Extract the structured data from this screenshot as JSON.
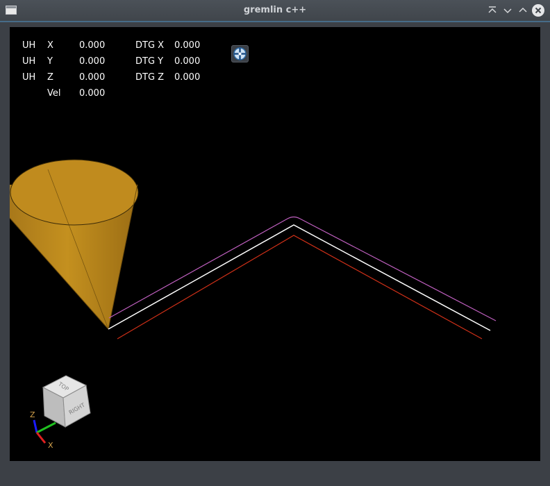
{
  "window": {
    "title": "gremlin c++"
  },
  "dro": {
    "rows": [
      {
        "prefix": "UH",
        "axis": "X",
        "value": "0.000",
        "dtg_label": "DTG X",
        "dtg_value": "0.000"
      },
      {
        "prefix": "UH",
        "axis": "Y",
        "value": "0.000",
        "dtg_label": "DTG Y",
        "dtg_value": "0.000"
      },
      {
        "prefix": "UH",
        "axis": "Z",
        "value": "0.000",
        "dtg_label": "DTG Z",
        "dtg_value": "0.000"
      }
    ],
    "vel_label": "Vel",
    "vel_value": "0.000"
  },
  "view_cube": {
    "top_label": "TOP",
    "right_label": "RIGHT"
  },
  "axes_indicator": {
    "z_label": "Z",
    "x_label": "X"
  },
  "colors": {
    "background": "#000000",
    "tool_cone": "#b8861e",
    "path_rapid": "#ffffff",
    "path_outer": "#c060c0",
    "path_inner": "#d03018",
    "axis_z": "#1a1aff",
    "axis_y": "#20c020",
    "axis_x": "#e02020",
    "axis_label": "#d4a24c"
  },
  "icons": {
    "zoom_fit": "crosshair-zoom-icon",
    "close": "close-icon",
    "minimize": "chevron-down-icon",
    "maximize": "chevron-up-icon",
    "keep_above": "keep-above-icon"
  }
}
